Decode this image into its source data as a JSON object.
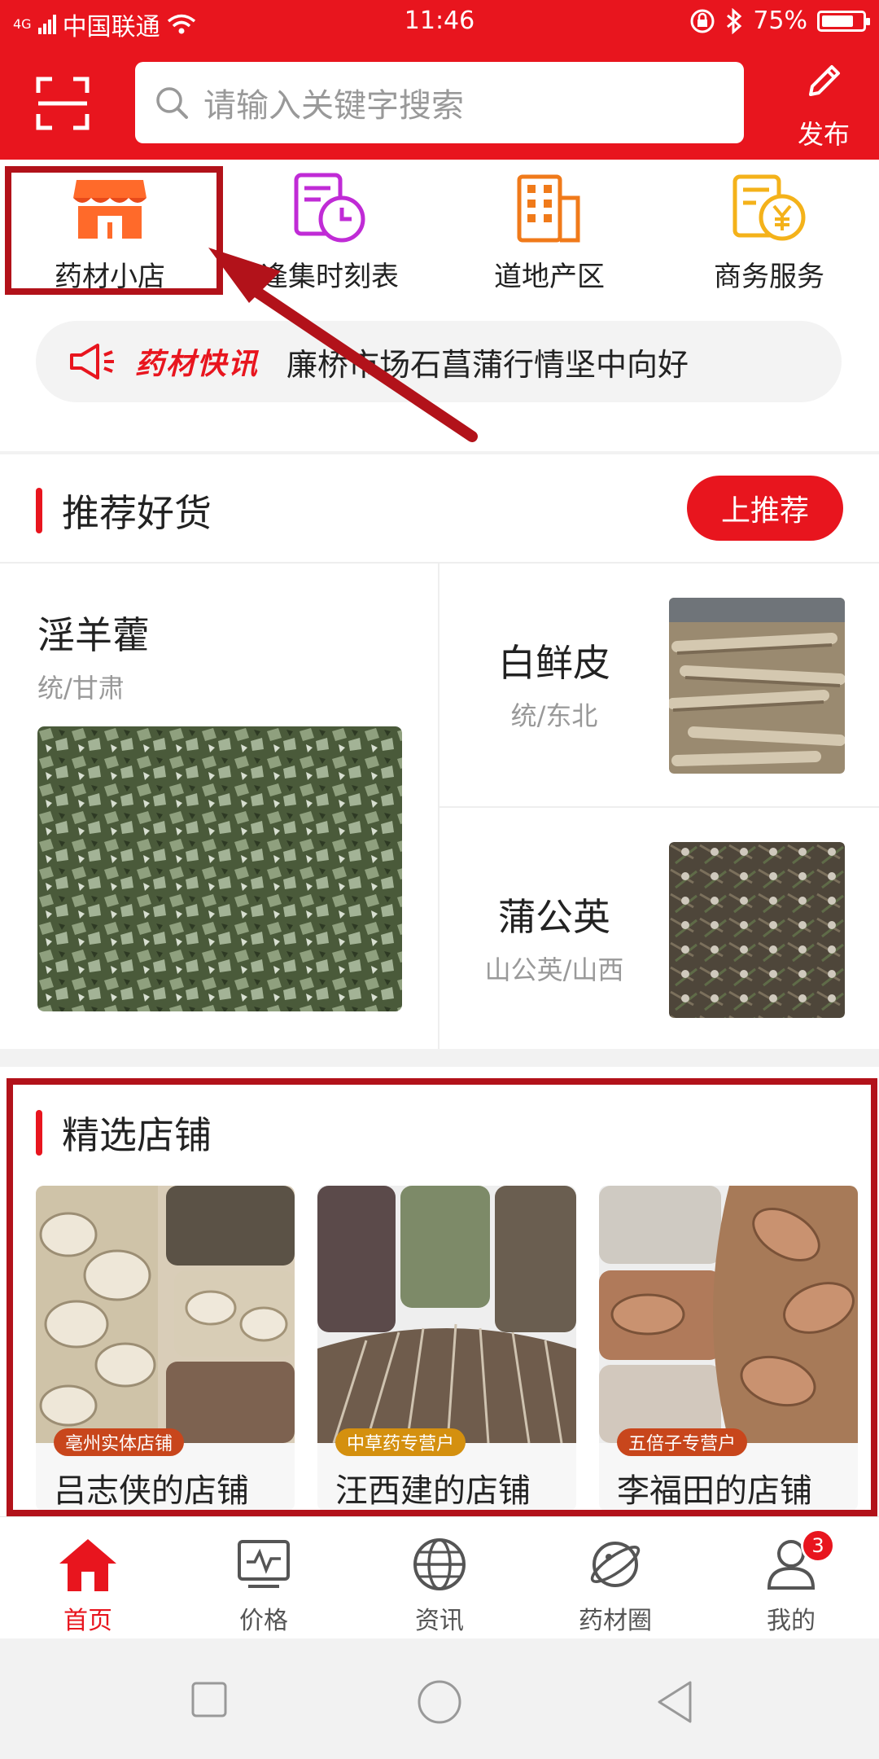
{
  "status_bar": {
    "carrier": "中国联通",
    "network": "4G",
    "time": "11:46",
    "battery": "75%"
  },
  "header": {
    "search_placeholder": "请输入关键字搜索",
    "publish_label": "发布"
  },
  "categories": [
    {
      "label": "药材小店",
      "icon": "shop-icon"
    },
    {
      "label": "逢集时刻表",
      "icon": "schedule-icon"
    },
    {
      "label": "道地产区",
      "icon": "building-icon"
    },
    {
      "label": "商务服务",
      "icon": "finance-icon"
    }
  ],
  "news": {
    "tag": "药材快讯",
    "text": "廉桥市场石菖蒲行情坚中向好"
  },
  "recommend": {
    "title": "推荐好货",
    "button": "上推荐",
    "items": [
      {
        "name": "淫羊藿",
        "sub": "统/甘肃"
      },
      {
        "name": "白鲜皮",
        "sub": "统/东北"
      },
      {
        "name": "蒲公英",
        "sub": "山公英/山西"
      }
    ]
  },
  "shops": {
    "title": "精选店铺",
    "items": [
      {
        "badge": "亳州实体店铺",
        "name": "吕志侠的店铺",
        "badge_color": "#c8461c"
      },
      {
        "badge": "中草药专营户",
        "name": "汪西建的店铺",
        "badge_color": "#d4900f"
      },
      {
        "badge": "五倍子专营户",
        "name": "李福田的店铺",
        "badge_color": "#c8461c"
      }
    ]
  },
  "tabbar": [
    {
      "label": "首页",
      "icon": "home-icon",
      "active": true
    },
    {
      "label": "价格",
      "icon": "price-chart-icon"
    },
    {
      "label": "资讯",
      "icon": "globe-icon"
    },
    {
      "label": "药材圈",
      "icon": "planet-icon"
    },
    {
      "label": "我的",
      "icon": "user-icon",
      "badge": "3"
    }
  ],
  "colors": {
    "brand": "#e8151e",
    "annotation": "#b2121a"
  }
}
